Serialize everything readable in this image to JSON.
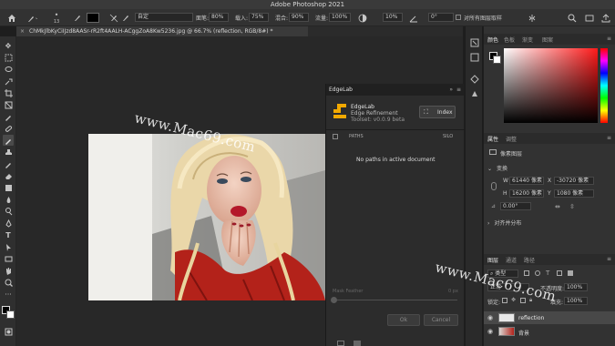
{
  "app": {
    "title": "Adobe Photoshop 2021"
  },
  "options_bar": {
    "tool_size": "13",
    "mode_label": "自定",
    "opacity_label": "面笔:",
    "opacity_value": "80%",
    "flow_label": "载入:",
    "flow_value": "75%",
    "blend_label": "混合:",
    "blend_value": "90%",
    "amount_label": "流量:",
    "amount_value": "100%",
    "smoothing_value": "10%",
    "angle_value": "0°",
    "sample_all_label": "对所有图层取样"
  },
  "document": {
    "tab_label": "ChMkJlbKyCiIJzd8AASr-rR2ft4AALH-ACggZoA8Kw5236.jpg @ 66.7% (reflection, RGB/8#) *",
    "close_glyph": "×"
  },
  "edgelab": {
    "header": "EdgeLab",
    "name": "EdgeLab",
    "subtitle": "Edge Refinement",
    "version": "Toolset: v0.0.9 beta",
    "index_label": "Index",
    "col_paths": "PATHS",
    "col_silo": "SILO",
    "empty_msg": "No paths in active document",
    "mask_feather_label": "Mask Feather",
    "mask_feather_value": "0 px",
    "ok_label": "Ok",
    "cancel_label": "Cancel"
  },
  "color_panel": {
    "tabs": [
      "颜色",
      "色板",
      "渐变",
      "图案"
    ],
    "accent": "#e02020"
  },
  "properties_panel": {
    "tabs": [
      "属性",
      "调整"
    ],
    "layer_type": "像素图层",
    "transform_label": "变换",
    "w_label": "W",
    "w_value": "61440 像素",
    "x_label": "X",
    "x_value": "-30720 像素",
    "h_label": "H",
    "h_value": "16200 像素",
    "y_label": "Y",
    "y_value": "1080 像素",
    "angle_value": "0.00°",
    "align_label": "对齐并分布"
  },
  "layers_panel": {
    "tabs": [
      "图层",
      "通道",
      "路径"
    ],
    "filter_label": "类型",
    "blend_mode": "正常",
    "opacity_label": "不透明度:",
    "opacity_value": "100%",
    "lock_label": "锁定:",
    "fill_label": "填充:",
    "fill_value": "100%",
    "layers": [
      {
        "name": "reflection",
        "selected": true
      },
      {
        "name": "背景",
        "selected": false
      }
    ]
  },
  "watermarks": [
    "www.Mac69.com",
    "www.Mac69.com"
  ],
  "brand_colors": {
    "edgelab_logo": "#f2a900",
    "panel_bg": "#323232",
    "canvas_bg": "#282828"
  }
}
